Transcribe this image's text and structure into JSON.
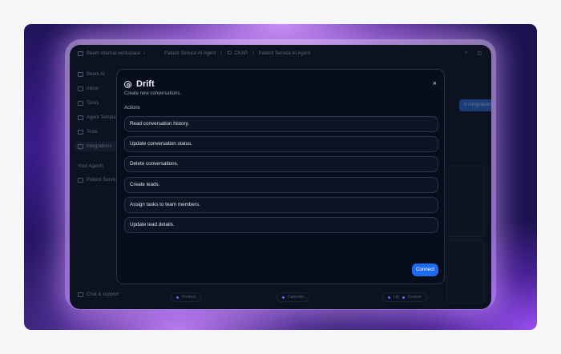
{
  "topbar": {
    "workspace": "Beam internal workspace",
    "crumbs": [
      "Patient Service AI Agent",
      "ID: CKAR",
      "Patient Service AI Agent"
    ]
  },
  "sidebar": {
    "items": [
      {
        "label": "Beam AI",
        "icon": "beam-icon"
      },
      {
        "label": "Inbox",
        "icon": "inbox-icon"
      },
      {
        "label": "Tasks",
        "icon": "tasks-icon"
      },
      {
        "label": "Agent Templates",
        "icon": "template-icon"
      },
      {
        "label": "Tools",
        "icon": "tools-icon"
      },
      {
        "label": "Integrations",
        "icon": "integrations-icon"
      }
    ],
    "section_label": "Your Agents",
    "agent": "Patient Service",
    "chat_support": "Chat & support"
  },
  "background": {
    "integration_button": "n Integration",
    "chips": [
      "Product",
      "Calendar",
      "Lig",
      "Custom"
    ]
  },
  "modal": {
    "title": "Drift",
    "subtitle": "Create new conversations.",
    "section": "Actions",
    "actions": [
      "Read conversation history.",
      "Update conversation status.",
      "Delete conversations.",
      "Create leads.",
      "Assign tasks to team members.",
      "Update lead details."
    ],
    "connect_label": "Connect",
    "close_glyph": "×"
  },
  "colors": {
    "accent": "#1f6bf0",
    "modal_bg": "#070d1a",
    "app_bg": "#0c1220"
  }
}
